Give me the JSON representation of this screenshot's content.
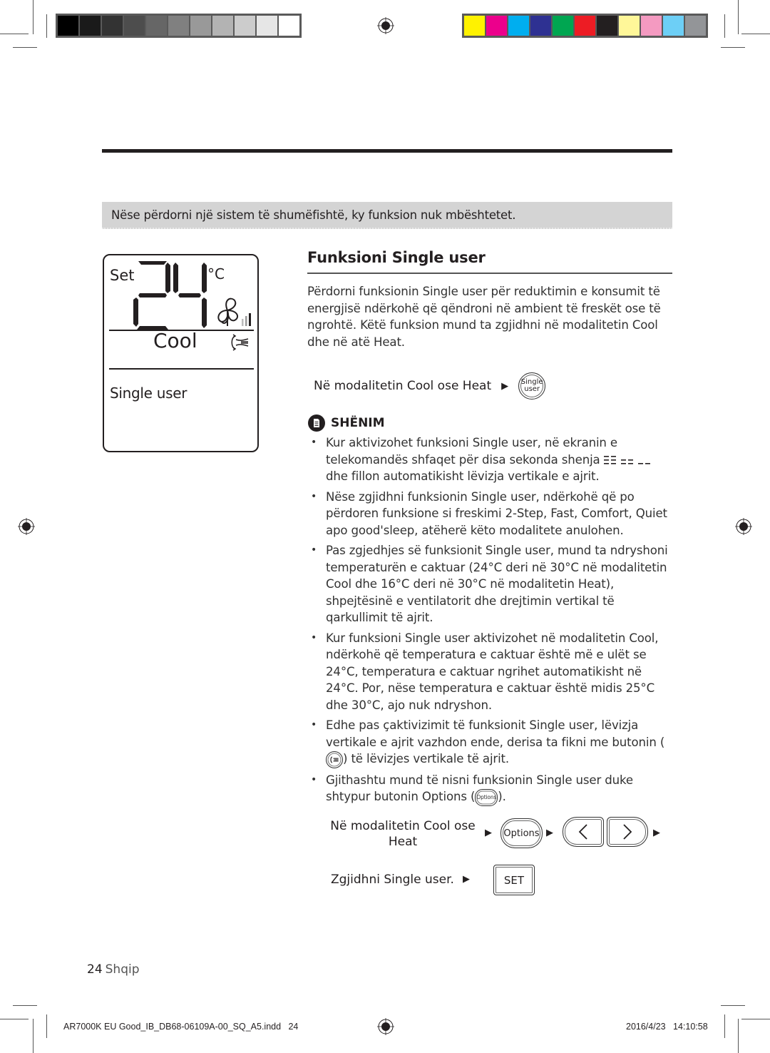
{
  "color_bars": {
    "grayscale": [
      "#000000",
      "#1a1a1a",
      "#333333",
      "#4d4d4d",
      "#666666",
      "#808080",
      "#999999",
      "#b3b3b3",
      "#cccccc",
      "#e6e6e6",
      "#ffffff"
    ],
    "process": [
      "#fff200",
      "#ec008c",
      "#00aeef",
      "#2e3192",
      "#00a651",
      "#ed1c24",
      "#231f20",
      "#fff799",
      "#f49ac1",
      "#6dcff6",
      "#939598"
    ]
  },
  "notice": {
    "text": "Nëse përdorni një sistem të shumëfishtë, ky funksion nuk mbështetet."
  },
  "display": {
    "set_label": "Set",
    "temperature": "24",
    "unit": "°C",
    "mode": "Cool",
    "function": "Single user",
    "fan_icon": "fan-icon",
    "fan_level": "3 bars (2 dimmed, 1 active)",
    "swing_icon": "vertical-swing-icon"
  },
  "section": {
    "title": "Funksioni Single user",
    "intro": "Përdorni funksionin Single user për reduktimin e konsumit të energjisë ndërkohë që qëndroni në ambient të freskët ose të ngrohtë. Këtë funksion mund ta zgjidhni në modalitetin Cool dhe në atë Heat.",
    "step1": {
      "label": "Në modalitetin Cool ose Heat",
      "arrow": "▶",
      "button_line1": "Single",
      "button_line2": "user"
    }
  },
  "note": {
    "icon": "note-icon",
    "title": "SHËNIM",
    "bullets": [
      {
        "text_before": "Kur aktivizohet funksioni Single user, në ekranin e telekomandës shfaqet për disa sekonda shenja",
        "text_after": "dhe fillon automatikisht lëvizja vertikale e ajrit."
      },
      {
        "text": "Nëse zgjidhni funksionin Single user, ndërkohë që po përdoren funksione si freskimi 2-Step, Fast, Comfort, Quiet apo good'sleep, atëherë këto modalitete anulohen."
      },
      {
        "text": "Pas zgjedhjes së funksionit Single user, mund ta ndryshoni temperaturën e caktuar (24°C deri në 30°C në modalitetin Cool dhe 16°C deri në 30°C në modalitetin Heat), shpejtësinë e ventilatorit dhe drejtimin vertikal të qarkullimit të ajrit."
      },
      {
        "text": "Kur funksioni Single user aktivizohet në modalitetin Cool, ndërkohë që temperatura e caktuar është më e ulët se 24°C, temperatura e caktuar ngrihet automatikisht në 24°C. Por, nëse temperatura e caktuar është midis 25°C dhe 30°C, ajo nuk ndryshon."
      },
      {
        "text_before": "Edhe pas çaktivizimit të funksionit Single user, lëvizja vertikale e ajrit vazhdon ende, derisa ta fikni me butonin (",
        "text_after": ") të lëvizjes vertikale të ajrit."
      },
      {
        "text_before": "Gjithashtu mund të nisni funksionin Single user duke shtypur butonin Options (",
        "button": "Options",
        "text_after": ")."
      }
    ]
  },
  "flow": {
    "step1_line1": "Në modalitetin Cool ose",
    "step1_line2": "Heat",
    "arrow": "▶",
    "options_button": "Options",
    "left_button": "‹",
    "right_button": "›",
    "step2_label": "Zgjidhni Single user.",
    "set_button": "SET"
  },
  "footer": {
    "page_number": "24",
    "language": "Shqip",
    "slug_file": "AR7000K EU Good_IB_DB68-06109A-00_SQ_A5.indd   24",
    "slug_date": "2016/4/23   14:10:58"
  }
}
